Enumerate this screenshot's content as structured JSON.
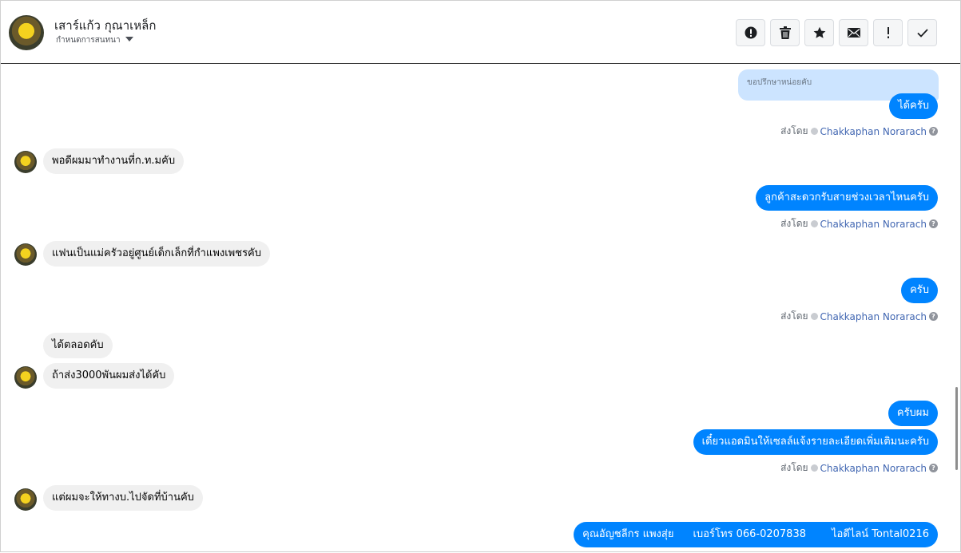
{
  "header": {
    "contact_name": "เสาร์แก้ว กุณาเหล็ก",
    "conversation_label": "กำหนดการสนทนา",
    "toolbar": [
      {
        "icon": "alert-circle-icon",
        "title": "spam"
      },
      {
        "icon": "trash-icon",
        "title": "delete"
      },
      {
        "icon": "star-icon",
        "title": "star"
      },
      {
        "icon": "envelope-icon",
        "title": "unread"
      },
      {
        "icon": "exclamation-icon",
        "title": "follow-up"
      },
      {
        "icon": "check-icon",
        "title": "done"
      }
    ]
  },
  "conversation": {
    "sent_prefix": "ส่งโดย",
    "agent_name": "Chakkaphan Norarach",
    "reply_preview": "ขอปรึกษาหน่อยคับ",
    "messages": [
      {
        "direction": "outgoing",
        "text": "ได้ครับ"
      },
      {
        "direction": "incoming",
        "text": "พอดีผมมาทำงานที่ก.ท.มคับ"
      },
      {
        "direction": "outgoing",
        "text": "ลูกค้าสะดวกรับสายช่วงเวลาไหนครับ"
      },
      {
        "direction": "incoming",
        "text": "แฟนเป็นแม่ครัวอยู่ศูนย์เด็กเล็กที่กำแพงเพชรคับ"
      },
      {
        "direction": "outgoing",
        "text": "ครับ"
      },
      {
        "direction": "incoming",
        "text": "ได้ตลอดคับ"
      },
      {
        "direction": "incoming",
        "text": "ถ้าส่ง3000พันผมส่งได้คับ"
      },
      {
        "direction": "outgoing",
        "text": "ครับผม"
      },
      {
        "direction": "outgoing",
        "text": "เดี๋ยวแอดมินให้เซลล์แจ้งรายละเอียดเพิ่มเติมนะครับ"
      },
      {
        "direction": "incoming",
        "text": "แต่ผมจะให้ทางบ.ไปจัดที่บ้านคับ"
      },
      {
        "direction": "outgoing",
        "parts": [
          "คุณอัญชลีกร แพงสุ่ย",
          "เบอร์โทร 066-0207838",
          "ไอดีไลน์ Tontal0216"
        ]
      }
    ]
  },
  "colors": {
    "outgoing_bubble": "#0084ff",
    "incoming_bubble": "#f0f0f0",
    "agent_link": "#4267b2",
    "reply_preview_bg": "#cce4ff"
  }
}
